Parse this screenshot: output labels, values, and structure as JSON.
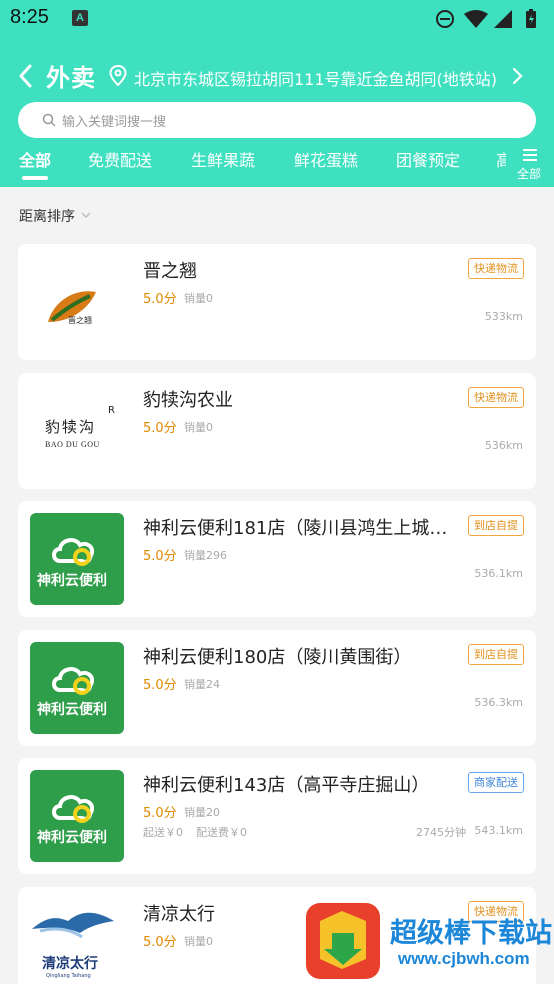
{
  "status_bar": {
    "time": "8:25",
    "notification_letter": "A"
  },
  "header": {
    "title": "外卖",
    "address": "北京市东城区锡拉胡同111号靠近金鱼胡同(地铁站)"
  },
  "search": {
    "placeholder": "输入关键词搜一搜"
  },
  "tabs": [
    {
      "label": "全部",
      "active": true
    },
    {
      "label": "免费配送"
    },
    {
      "label": "生鲜果蔬"
    },
    {
      "label": "鲜花蛋糕"
    },
    {
      "label": "团餐预定"
    },
    {
      "label": "高"
    }
  ],
  "all_menu_label": "全部",
  "sort": {
    "label": "距离排序"
  },
  "stores": [
    {
      "name": "晋之翘",
      "rating": "5.0分",
      "sales": "销量0",
      "badge": "快递物流",
      "distance": "533km",
      "logo_text": "晋之翘"
    },
    {
      "name": "豹犊沟农业",
      "rating": "5.0分",
      "sales": "销量0",
      "badge": "快递物流",
      "distance": "536km",
      "logo_text": "豹犊沟",
      "logo_sub": "BAO DU GOU",
      "logo_mark": "R"
    },
    {
      "name": "神利云便利181店（陵川县鸿生上城…",
      "rating": "5.0分",
      "sales": "销量296",
      "badge": "到店自提",
      "distance": "536.1km",
      "logo_text": "神利云便利"
    },
    {
      "name": "神利云便利180店（陵川黄围街）",
      "rating": "5.0分",
      "sales": "销量24",
      "badge": "到店自提",
      "distance": "536.3km",
      "logo_text": "神利云便利"
    },
    {
      "name": "神利云便利143店（高平寺庄掘山）",
      "rating": "5.0分",
      "sales": "销量20",
      "badge": "商家配送",
      "badge_style": "blue",
      "distance": "543.1km",
      "min_order": "起送￥0",
      "delivery_fee": "配送费￥0",
      "delivery_time": "2745分钟",
      "logo_text": "神利云便利"
    },
    {
      "name": "清凉太行",
      "rating": "5.0分",
      "sales": "销量0",
      "badge": "快递物流",
      "logo_text": "清凉太行",
      "logo_sub": "Qingliang Taihang"
    }
  ],
  "watermark": {
    "title": "超级棒下载站",
    "url": "www.cjbwh.com"
  },
  "colors": {
    "header": "#3fe0c0",
    "rating": "#e08a00",
    "badge_orange": "#f0a640",
    "badge_blue": "#6aa6ee",
    "logo_green": "#2f9e4a"
  }
}
